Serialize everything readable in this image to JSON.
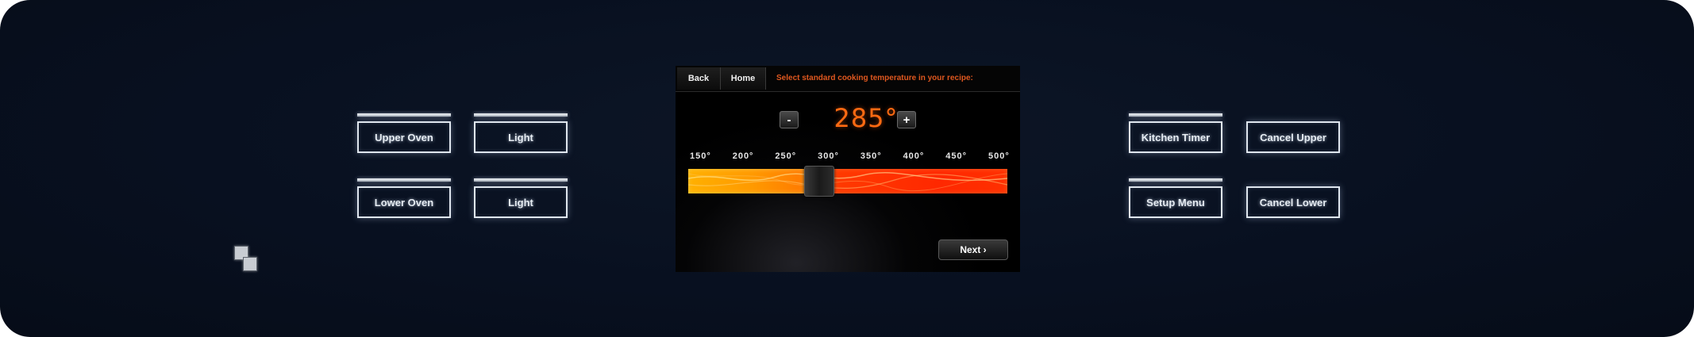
{
  "colors": {
    "panel_background": "#081020",
    "accent_temperature": "#ff6a12",
    "prompt_text": "#e0581f",
    "key_outline": "#dfe6ee",
    "bar_low": "#ffb000",
    "bar_high": "#ff2800"
  },
  "left_keys": {
    "upper_oven": "Upper Oven",
    "upper_light": "Light",
    "lower_oven": "Lower Oven",
    "lower_light": "Light"
  },
  "right_keys": {
    "kitchen_timer": "Kitchen Timer",
    "cancel_upper": "Cancel Upper",
    "setup_menu": "Setup Menu",
    "cancel_lower": "Cancel Lower"
  },
  "logo": {
    "icon": "brand-logo-icon"
  },
  "screen": {
    "nav": {
      "back": "Back",
      "home": "Home",
      "prompt": "Select standard cooking temperature in your recipe:"
    },
    "temperature": {
      "minus": "-",
      "plus": "+",
      "value": "285°",
      "current": 285,
      "min": 150,
      "max": 500
    },
    "scale": [
      "150°",
      "200°",
      "250°",
      "300°",
      "350°",
      "400°",
      "450°",
      "500°"
    ],
    "next_label": "Next ›"
  }
}
